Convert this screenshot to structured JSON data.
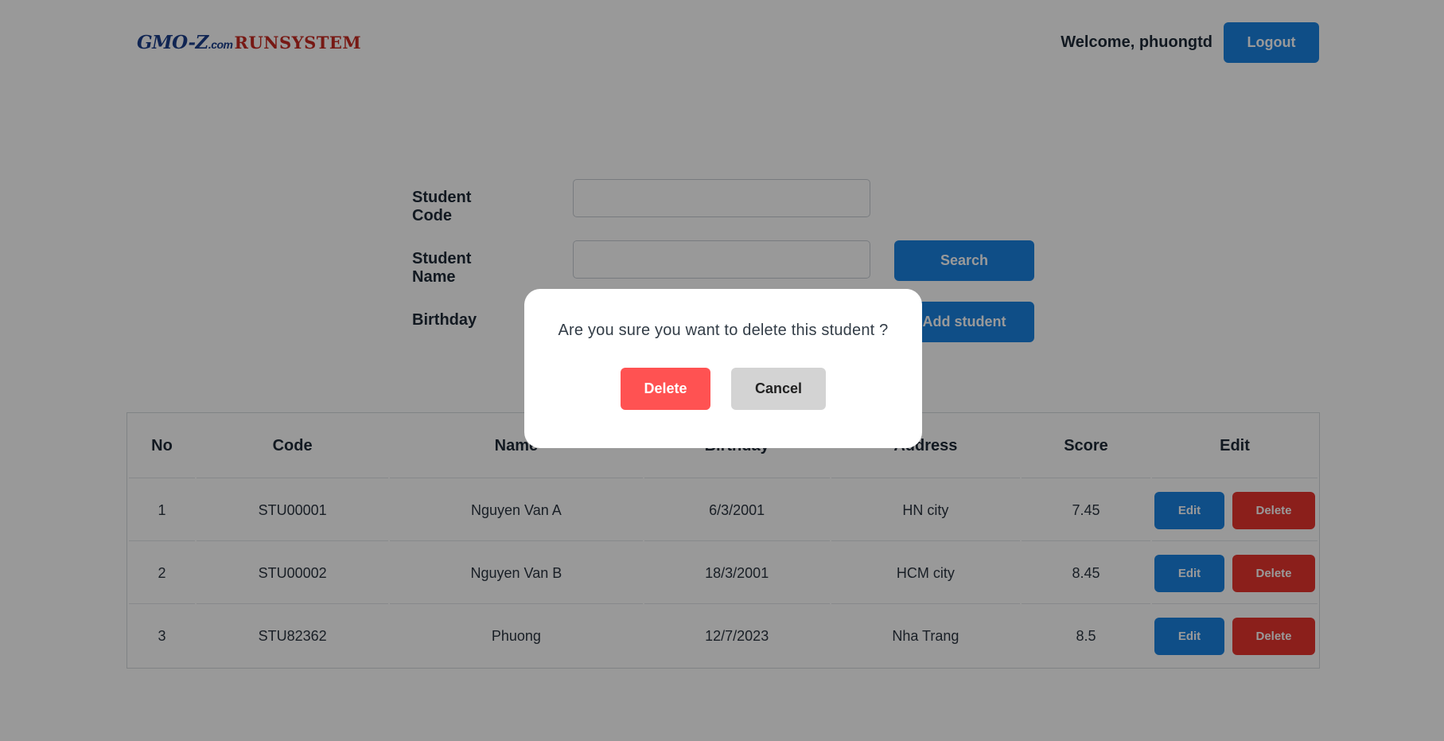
{
  "header": {
    "logo_left": "GMO-Z",
    "logo_dot": ".com",
    "logo_right": "RUNSYSTEM",
    "welcome": "Welcome, phuongtd",
    "logout_label": "Logout"
  },
  "form": {
    "code_label": "Student Code",
    "name_label": "Student Name",
    "birthday_label": "Birthday",
    "search_label": "Search",
    "add_label": "Add student",
    "code_value": "",
    "name_value": ""
  },
  "table": {
    "headers": [
      "No",
      "Code",
      "Name",
      "Birthday",
      "Address",
      "Score",
      "Edit"
    ],
    "edit_label": "Edit",
    "delete_label": "Delete",
    "rows": [
      {
        "no": "1",
        "code": "STU00001",
        "name": "Nguyen Van A",
        "birthday": "6/3/2001",
        "address": "HN city",
        "score": "7.45"
      },
      {
        "no": "2",
        "code": "STU00002",
        "name": "Nguyen Van B",
        "birthday": "18/3/2001",
        "address": "HCM city",
        "score": "8.45"
      },
      {
        "no": "3",
        "code": "STU82362",
        "name": "Phuong",
        "birthday": "12/7/2023",
        "address": "Nha Trang",
        "score": "8.5"
      }
    ]
  },
  "modal": {
    "message": "Are you sure you want to delete this student ?",
    "delete_label": "Delete",
    "cancel_label": "Cancel"
  },
  "colors": {
    "primary": "#1a82e2",
    "danger": "#e8342e",
    "modal_delete": "#ff5252",
    "modal_cancel": "#d3d3d3",
    "overlay": "rgba(0,0,0,0.4)"
  }
}
